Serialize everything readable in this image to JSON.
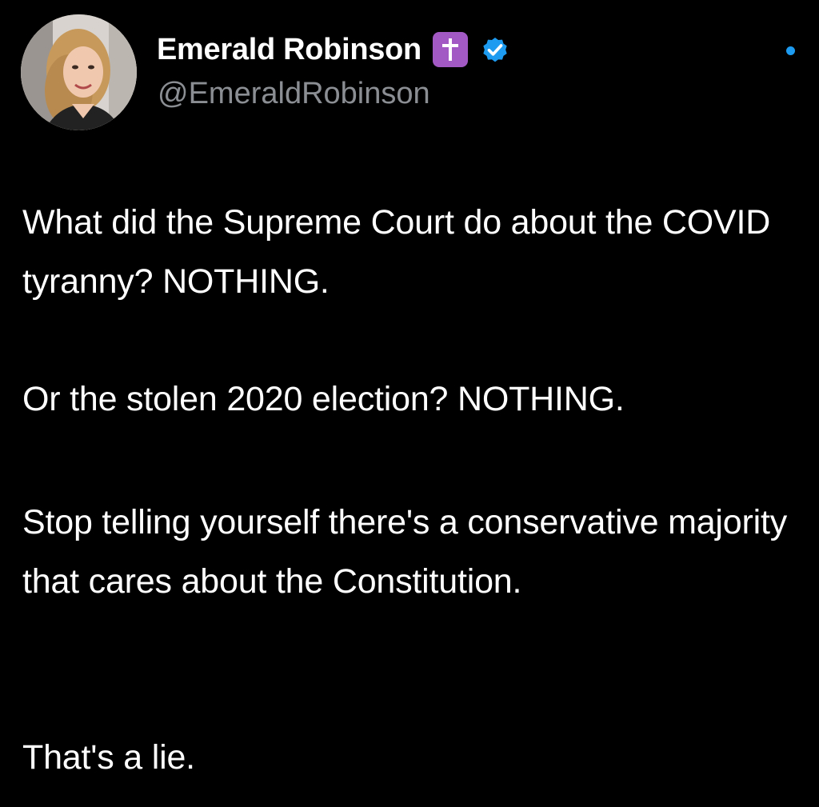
{
  "author": {
    "display_name": "Emerald Robinson",
    "handle": "@EmeraldRobinson",
    "badges": [
      "cross-icon",
      "verified-icon"
    ],
    "verified_color": "#1d9bf0",
    "cross_badge_color": "#a259c4"
  },
  "tweet": {
    "paragraphs": [
      "What did the Supreme Court do about the COVID tyranny? NOTHING.",
      "Or the stolen 2020 election? NOTHING.",
      "Stop telling yourself there's a conservative majority that cares about the Constitution.",
      "That's a lie."
    ]
  },
  "colors": {
    "background": "#000000",
    "text": "#ffffff",
    "handle": "#8b8f94",
    "accent": "#1d9bf0"
  }
}
